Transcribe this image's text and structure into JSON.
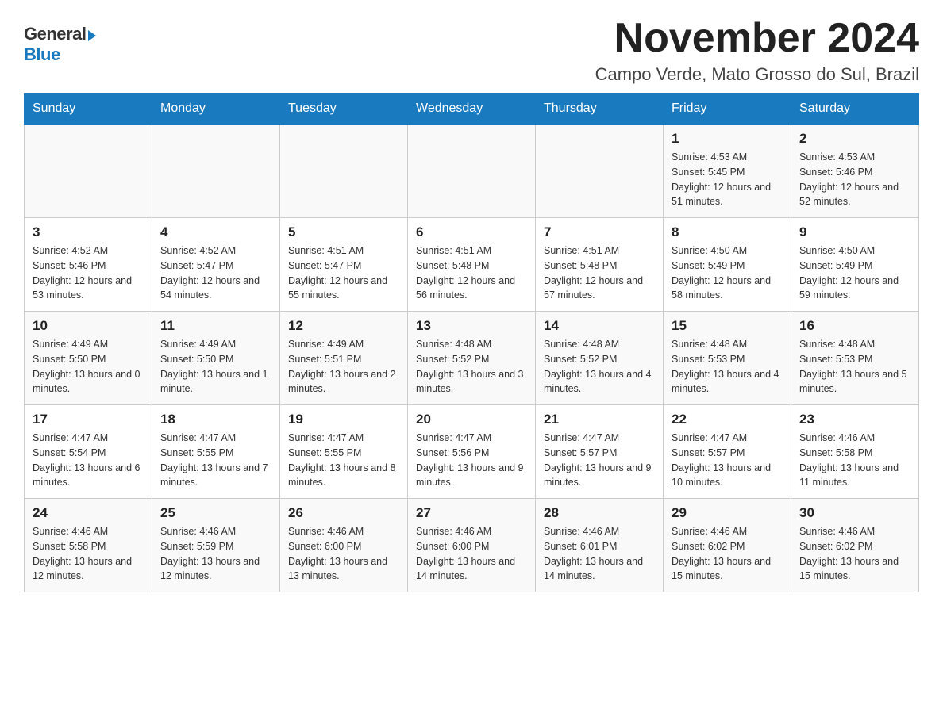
{
  "logo": {
    "general": "General",
    "blue": "Blue"
  },
  "header": {
    "month_year": "November 2024",
    "location": "Campo Verde, Mato Grosso do Sul, Brazil"
  },
  "days_of_week": [
    "Sunday",
    "Monday",
    "Tuesday",
    "Wednesday",
    "Thursday",
    "Friday",
    "Saturday"
  ],
  "weeks": [
    {
      "days": [
        {
          "number": "",
          "info": ""
        },
        {
          "number": "",
          "info": ""
        },
        {
          "number": "",
          "info": ""
        },
        {
          "number": "",
          "info": ""
        },
        {
          "number": "",
          "info": ""
        },
        {
          "number": "1",
          "info": "Sunrise: 4:53 AM\nSunset: 5:45 PM\nDaylight: 12 hours and 51 minutes."
        },
        {
          "number": "2",
          "info": "Sunrise: 4:53 AM\nSunset: 5:46 PM\nDaylight: 12 hours and 52 minutes."
        }
      ]
    },
    {
      "days": [
        {
          "number": "3",
          "info": "Sunrise: 4:52 AM\nSunset: 5:46 PM\nDaylight: 12 hours and 53 minutes."
        },
        {
          "number": "4",
          "info": "Sunrise: 4:52 AM\nSunset: 5:47 PM\nDaylight: 12 hours and 54 minutes."
        },
        {
          "number": "5",
          "info": "Sunrise: 4:51 AM\nSunset: 5:47 PM\nDaylight: 12 hours and 55 minutes."
        },
        {
          "number": "6",
          "info": "Sunrise: 4:51 AM\nSunset: 5:48 PM\nDaylight: 12 hours and 56 minutes."
        },
        {
          "number": "7",
          "info": "Sunrise: 4:51 AM\nSunset: 5:48 PM\nDaylight: 12 hours and 57 minutes."
        },
        {
          "number": "8",
          "info": "Sunrise: 4:50 AM\nSunset: 5:49 PM\nDaylight: 12 hours and 58 minutes."
        },
        {
          "number": "9",
          "info": "Sunrise: 4:50 AM\nSunset: 5:49 PM\nDaylight: 12 hours and 59 minutes."
        }
      ]
    },
    {
      "days": [
        {
          "number": "10",
          "info": "Sunrise: 4:49 AM\nSunset: 5:50 PM\nDaylight: 13 hours and 0 minutes."
        },
        {
          "number": "11",
          "info": "Sunrise: 4:49 AM\nSunset: 5:50 PM\nDaylight: 13 hours and 1 minute."
        },
        {
          "number": "12",
          "info": "Sunrise: 4:49 AM\nSunset: 5:51 PM\nDaylight: 13 hours and 2 minutes."
        },
        {
          "number": "13",
          "info": "Sunrise: 4:48 AM\nSunset: 5:52 PM\nDaylight: 13 hours and 3 minutes."
        },
        {
          "number": "14",
          "info": "Sunrise: 4:48 AM\nSunset: 5:52 PM\nDaylight: 13 hours and 4 minutes."
        },
        {
          "number": "15",
          "info": "Sunrise: 4:48 AM\nSunset: 5:53 PM\nDaylight: 13 hours and 4 minutes."
        },
        {
          "number": "16",
          "info": "Sunrise: 4:48 AM\nSunset: 5:53 PM\nDaylight: 13 hours and 5 minutes."
        }
      ]
    },
    {
      "days": [
        {
          "number": "17",
          "info": "Sunrise: 4:47 AM\nSunset: 5:54 PM\nDaylight: 13 hours and 6 minutes."
        },
        {
          "number": "18",
          "info": "Sunrise: 4:47 AM\nSunset: 5:55 PM\nDaylight: 13 hours and 7 minutes."
        },
        {
          "number": "19",
          "info": "Sunrise: 4:47 AM\nSunset: 5:55 PM\nDaylight: 13 hours and 8 minutes."
        },
        {
          "number": "20",
          "info": "Sunrise: 4:47 AM\nSunset: 5:56 PM\nDaylight: 13 hours and 9 minutes."
        },
        {
          "number": "21",
          "info": "Sunrise: 4:47 AM\nSunset: 5:57 PM\nDaylight: 13 hours and 9 minutes."
        },
        {
          "number": "22",
          "info": "Sunrise: 4:47 AM\nSunset: 5:57 PM\nDaylight: 13 hours and 10 minutes."
        },
        {
          "number": "23",
          "info": "Sunrise: 4:46 AM\nSunset: 5:58 PM\nDaylight: 13 hours and 11 minutes."
        }
      ]
    },
    {
      "days": [
        {
          "number": "24",
          "info": "Sunrise: 4:46 AM\nSunset: 5:58 PM\nDaylight: 13 hours and 12 minutes."
        },
        {
          "number": "25",
          "info": "Sunrise: 4:46 AM\nSunset: 5:59 PM\nDaylight: 13 hours and 12 minutes."
        },
        {
          "number": "26",
          "info": "Sunrise: 4:46 AM\nSunset: 6:00 PM\nDaylight: 13 hours and 13 minutes."
        },
        {
          "number": "27",
          "info": "Sunrise: 4:46 AM\nSunset: 6:00 PM\nDaylight: 13 hours and 14 minutes."
        },
        {
          "number": "28",
          "info": "Sunrise: 4:46 AM\nSunset: 6:01 PM\nDaylight: 13 hours and 14 minutes."
        },
        {
          "number": "29",
          "info": "Sunrise: 4:46 AM\nSunset: 6:02 PM\nDaylight: 13 hours and 15 minutes."
        },
        {
          "number": "30",
          "info": "Sunrise: 4:46 AM\nSunset: 6:02 PM\nDaylight: 13 hours and 15 minutes."
        }
      ]
    }
  ]
}
